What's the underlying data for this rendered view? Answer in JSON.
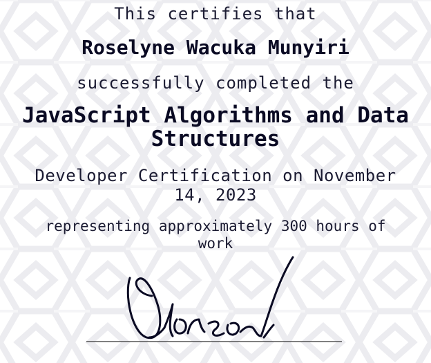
{
  "certificate": {
    "certifies_text": "This certifies that",
    "recipient_name": "Roselyne Wacuka Munyiri",
    "completed_text": "successfully completed the",
    "course_title": "JavaScript Algorithms and Data Structures",
    "certification_line": "Developer Certification on November 14, 2023",
    "hours_line": "representing approximately 300 hours of work"
  },
  "signature": {
    "icon": "handwritten-signature",
    "stroke_color": "#0a0a23"
  },
  "colors": {
    "background": "#ffffff",
    "pattern": "#e6e6ea",
    "text": "#0a0a23"
  }
}
